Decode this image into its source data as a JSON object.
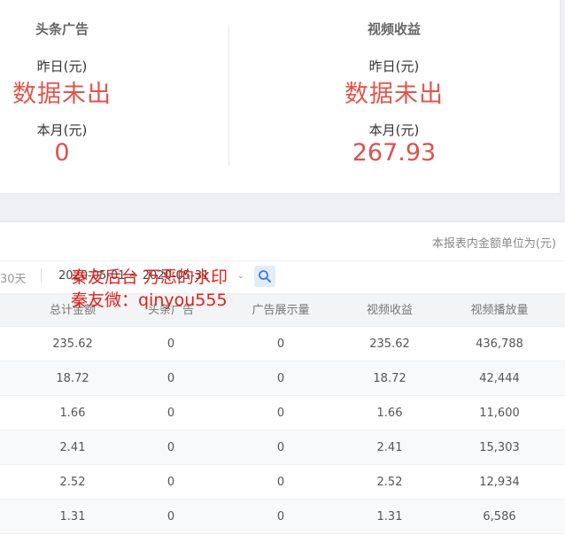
{
  "summary": {
    "left": {
      "heading": "头条广告",
      "yesterday_label": "昨日(元)",
      "yesterday_value": "数据未出",
      "month_label": "本月(元)",
      "month_value": "0"
    },
    "right": {
      "heading": "视频收益",
      "yesterday_label": "昨日(元)",
      "yesterday_value": "数据未出",
      "month_label": "本月(元)",
      "month_value": "267.93"
    }
  },
  "report": {
    "unit_note": "本报表内金额单位为(元)",
    "range_tab": "30天",
    "date_range": "2020-05-01 ~ 2020-05-31",
    "columns": [
      "总计金额",
      "头条广告",
      "广告展示量",
      "视频收益",
      "视频播放量"
    ],
    "rows": [
      [
        "235.62",
        "0",
        "0",
        "235.62",
        "436,788"
      ],
      [
        "18.72",
        "0",
        "0",
        "18.72",
        "42,444"
      ],
      [
        "1.66",
        "0",
        "0",
        "1.66",
        "11,600"
      ],
      [
        "2.41",
        "0",
        "0",
        "2.41",
        "15,303"
      ],
      [
        "2.52",
        "0",
        "0",
        "2.52",
        "12,934"
      ],
      [
        "1.31",
        "0",
        "0",
        "1.31",
        "6,586"
      ]
    ]
  },
  "watermark": {
    "line1": "秦友后台 万恶的水印",
    "line2": "秦友微：qinyou555"
  },
  "icons": {
    "search": "search-icon",
    "dropdown": "chevron-down-icon"
  },
  "colors": {
    "accent_red": "#d9534f",
    "search_bg": "#e3ecfa"
  }
}
